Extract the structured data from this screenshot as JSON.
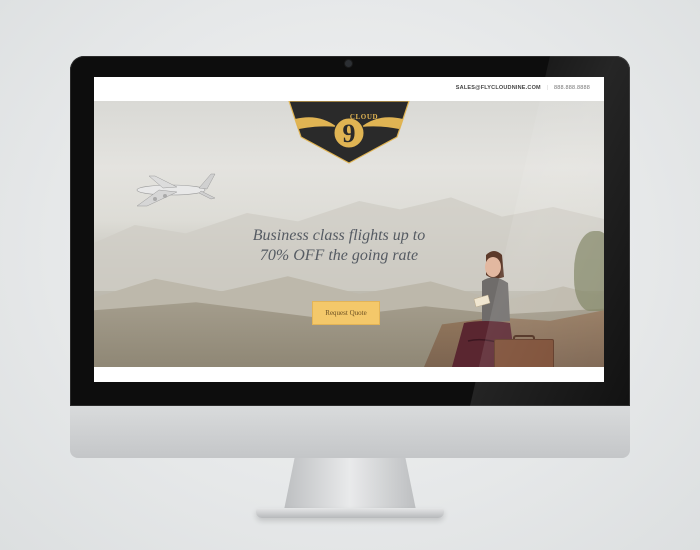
{
  "site": {
    "logo": {
      "wordmark": "CLOUD",
      "numeral": "9",
      "colors": {
        "shield": "#2a2a2a",
        "gold": "#e0b453"
      }
    },
    "topbar": {
      "email": "SALES@FLYCLOUDNINE.COM",
      "phone": "888.888.8888"
    },
    "hero": {
      "headline_line1": "Business class flights up to",
      "headline_line2": "70% OFF the going rate",
      "cta_label": "Request Quote",
      "slider": {
        "count": 5,
        "active_index": 4
      }
    },
    "colors": {
      "accent": "#f4c86a",
      "text": "#555b63"
    },
    "icons": [
      "airplane-illustration",
      "winged-logo"
    ]
  }
}
